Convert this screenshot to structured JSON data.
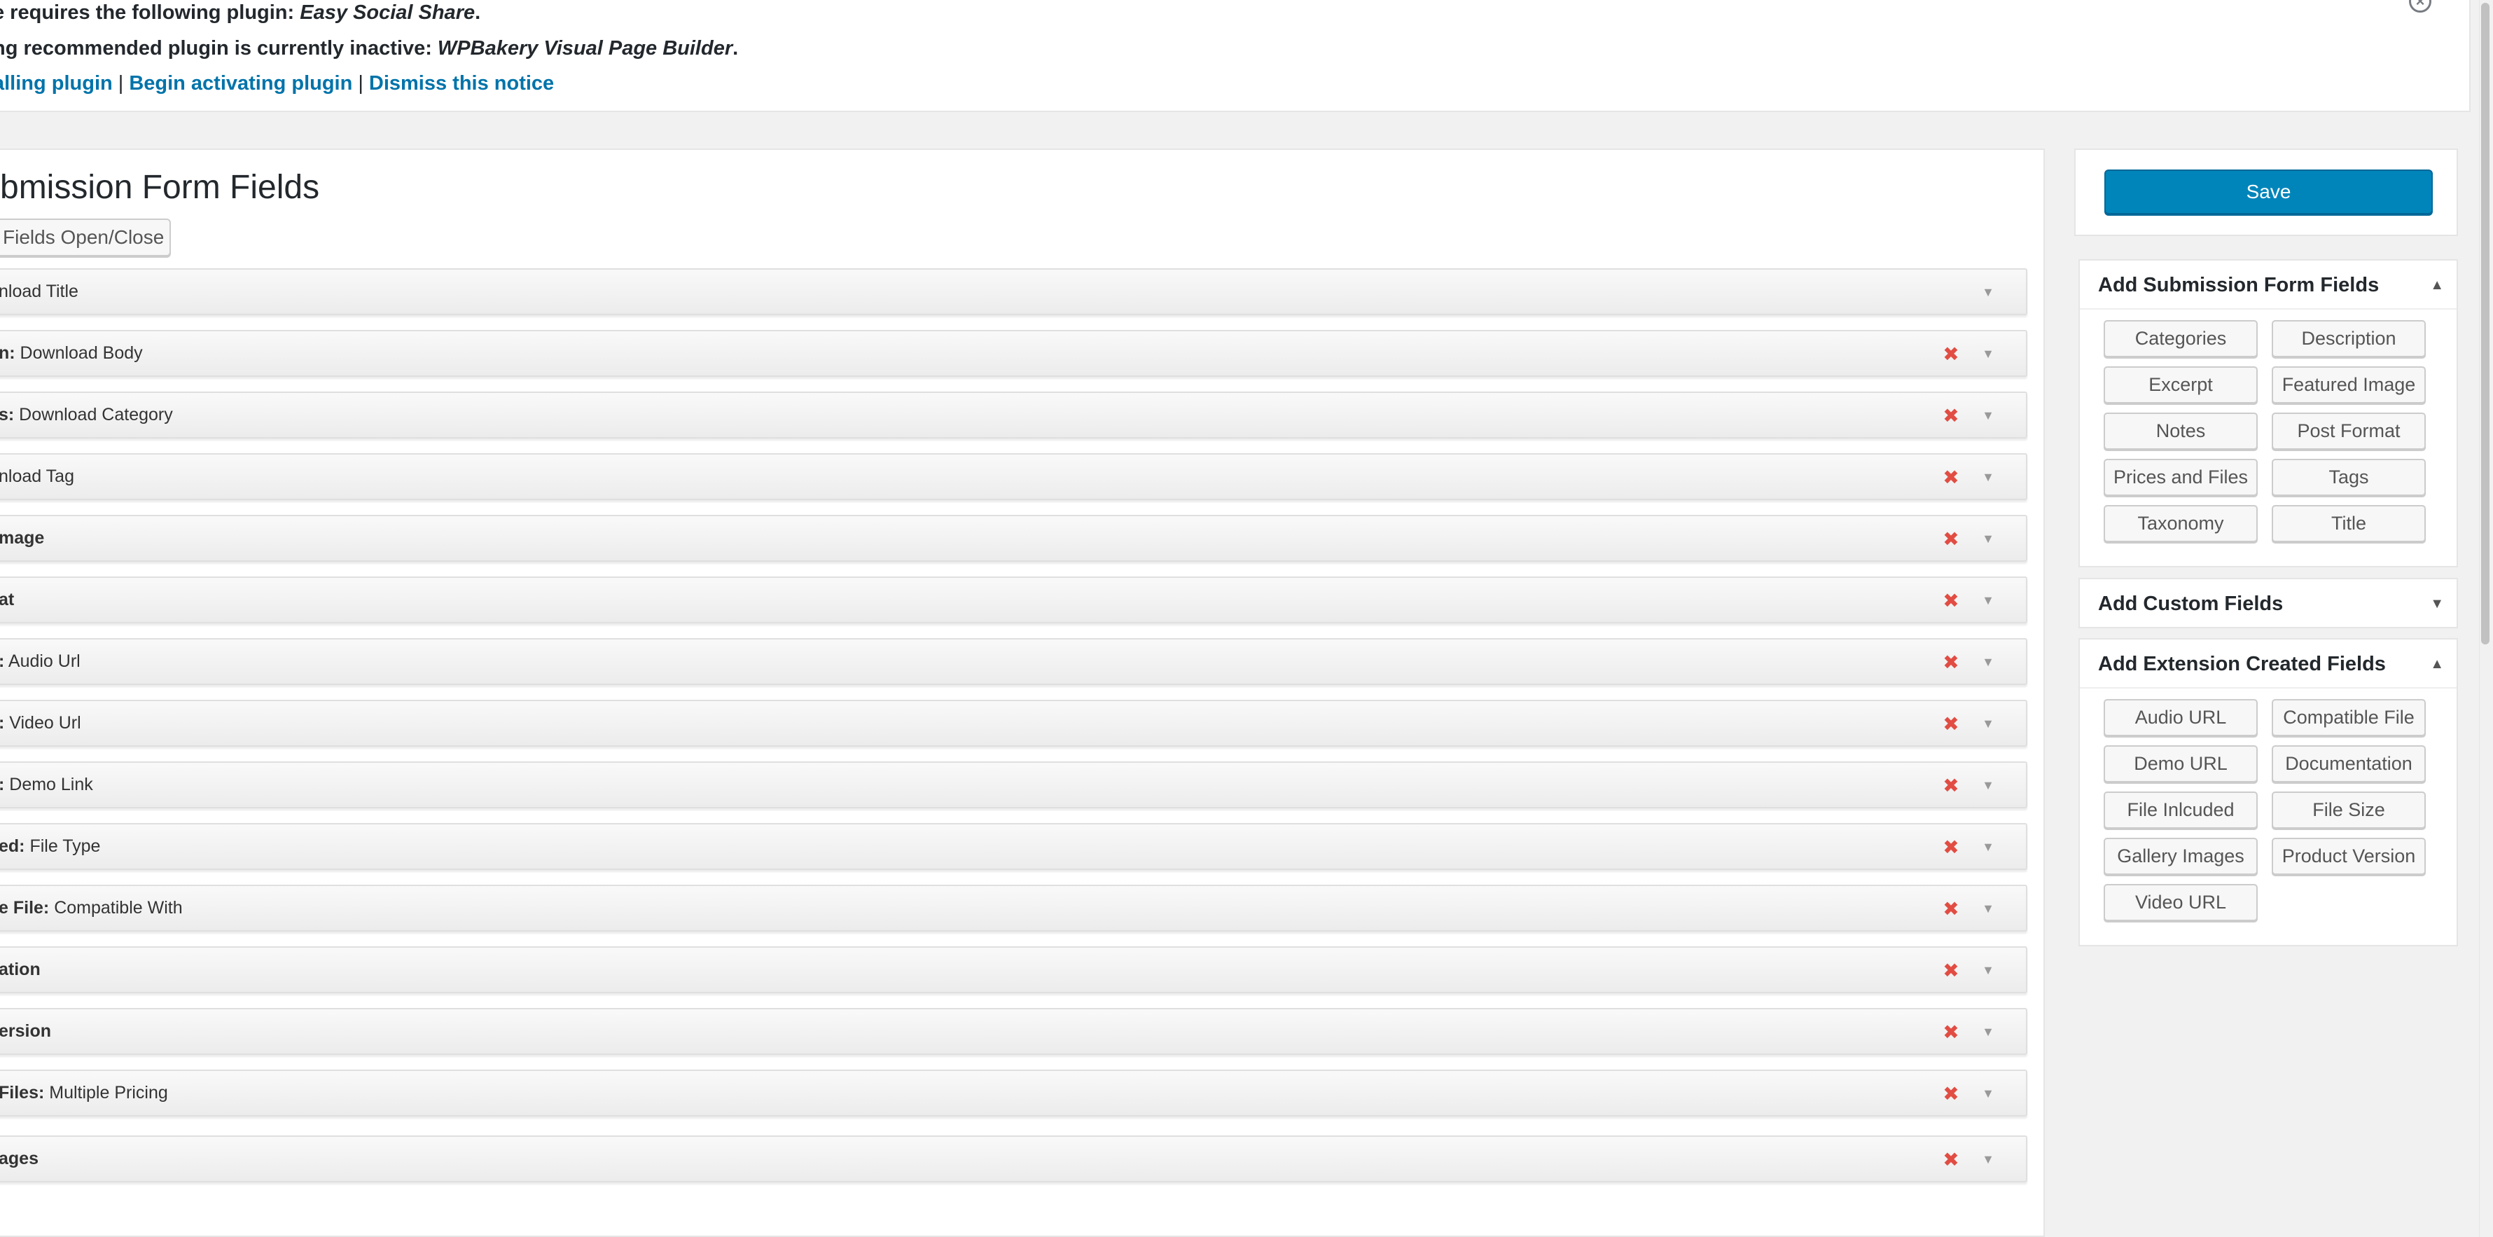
{
  "notice": {
    "line1_prefix": "e requires the following plugin: ",
    "line1_plugin": "Easy Social Share",
    "line1_suffix": ".",
    "line2_prefix": "ng recommended plugin is currently inactive: ",
    "line2_plugin": "WPBakery Visual Page Builder",
    "line2_suffix": ".",
    "links": [
      "alling plugin",
      "Begin activating plugin",
      "Dismiss this notice"
    ],
    "separator": "|"
  },
  "main": {
    "title": "bmission Form Fields",
    "toggle_label": "Fields Open/Close",
    "fields": [
      {
        "bold": "",
        "text": "nload Title",
        "deletable": false
      },
      {
        "bold": "n:",
        "text": " Download Body",
        "deletable": true
      },
      {
        "bold": "s:",
        "text": " Download Category",
        "deletable": true
      },
      {
        "bold": "",
        "text": "nload Tag",
        "deletable": true
      },
      {
        "bold": "mage",
        "text": "",
        "deletable": true
      },
      {
        "bold": "at",
        "text": "",
        "deletable": true
      },
      {
        "bold": ":",
        "text": " Audio Url",
        "deletable": true
      },
      {
        "bold": ":",
        "text": " Video Url",
        "deletable": true
      },
      {
        "bold": ":",
        "text": " Demo Link",
        "deletable": true
      },
      {
        "bold": "ed:",
        "text": " File Type",
        "deletable": true
      },
      {
        "bold": "e File:",
        "text": " Compatible With",
        "deletable": true
      },
      {
        "bold": "ation",
        "text": "",
        "deletable": true
      },
      {
        "bold": "ersion",
        "text": "",
        "deletable": true
      },
      {
        "bold": " Files:",
        "text": " Multiple Pricing",
        "deletable": true
      },
      {
        "bold": "ages",
        "text": "",
        "deletable": true
      }
    ]
  },
  "sidebar": {
    "save_label": "Save",
    "submission_box": {
      "title": "Add Submission Form Fields",
      "buttons": [
        "Categories",
        "Description",
        "Excerpt",
        "Featured Image",
        "Notes",
        "Post Format",
        "Prices and Files",
        "Tags",
        "Taxonomy",
        "Title"
      ]
    },
    "custom_box": {
      "title": "Add Custom Fields"
    },
    "extension_box": {
      "title": "Add Extension Created Fields",
      "buttons": [
        "Audio URL",
        "Compatible File",
        "Demo URL",
        "Documentation",
        "File Inlcuded",
        "File Size",
        "Gallery Images",
        "Product Version",
        "Video URL"
      ]
    }
  },
  "icons": {
    "delete": "delete-icon",
    "expand": "triangle-down-icon",
    "collapse": "triangle-up-icon",
    "dismiss": "close-circle-icon"
  },
  "colors": {
    "link": "#0073aa",
    "primary_button": "#0085ba",
    "delete": "#e14d43"
  }
}
